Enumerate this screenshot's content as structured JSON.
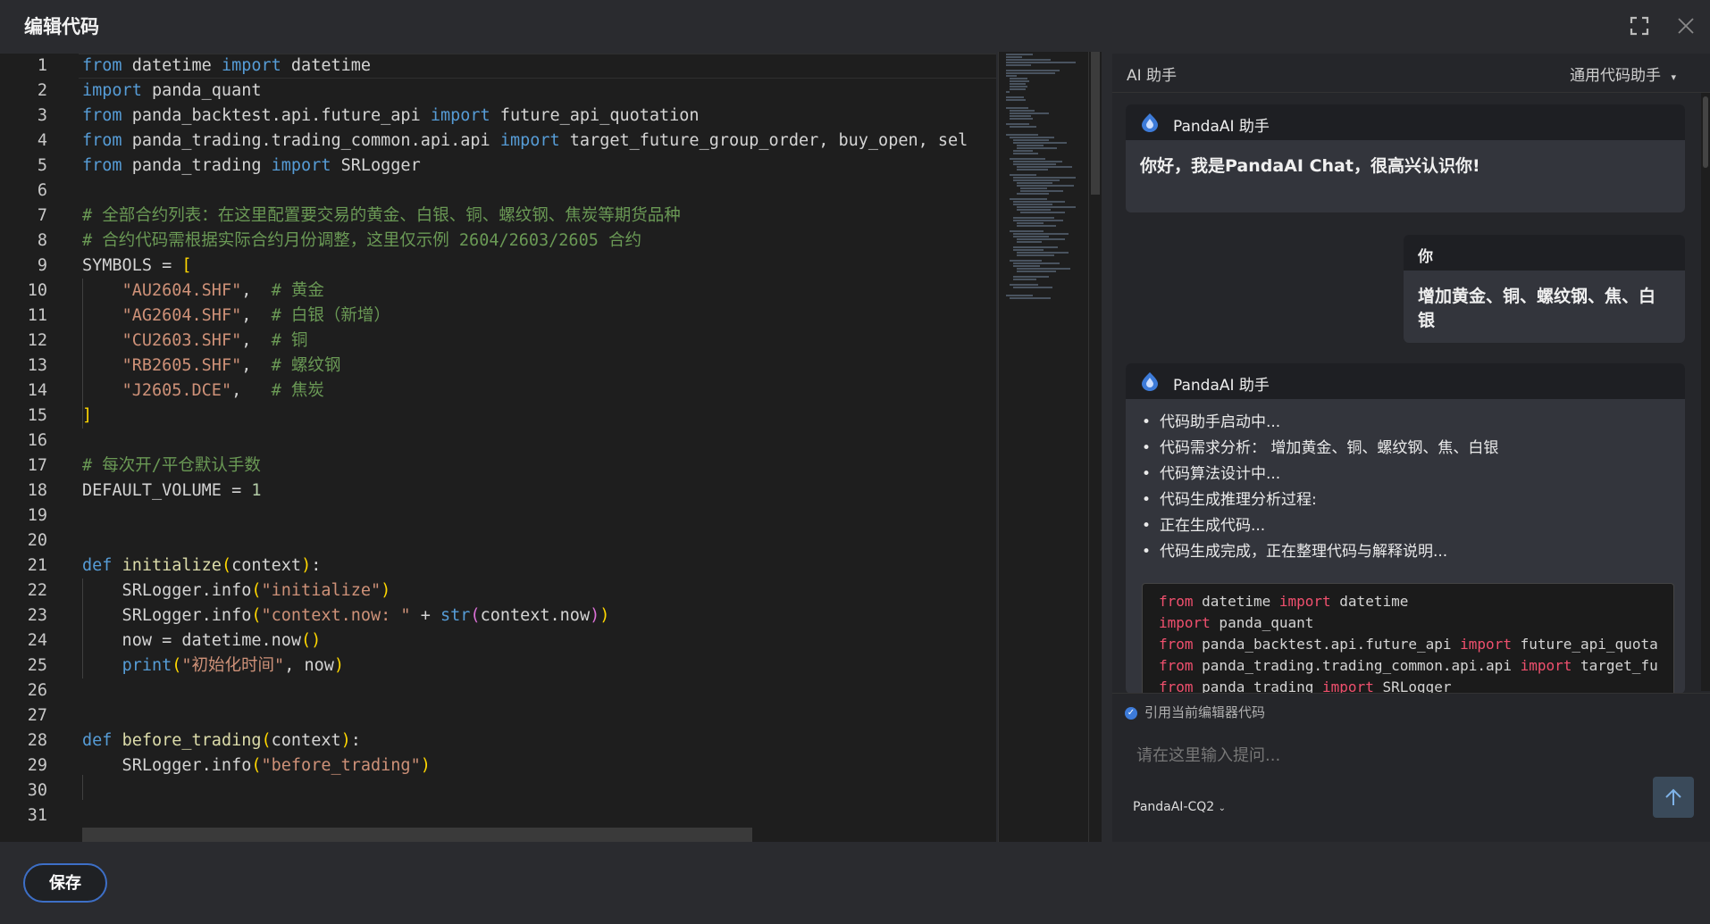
{
  "header": {
    "title": "编辑代码",
    "icons": [
      "fullscreen-icon",
      "close-icon"
    ]
  },
  "editor": {
    "line_numbers": [
      "1",
      "2",
      "3",
      "4",
      "5",
      "6",
      "7",
      "8",
      "9",
      "10",
      "11",
      "12",
      "13",
      "14",
      "15",
      "16",
      "17",
      "18",
      "19",
      "20",
      "21",
      "22",
      "23",
      "24",
      "25",
      "26",
      "27",
      "28",
      "29",
      "30",
      "31"
    ]
  },
  "ai_panel": {
    "title": "AI 助手",
    "mode": "通用代码助手",
    "assistant_name": "PandaAI 助手",
    "greeting": "你好，我是PandaAI Chat，很高兴认识你!",
    "user_name": "你",
    "user_message": "增加黄金、铜、螺纹钢、焦、白银",
    "steps": [
      "代码助手启动中...",
      "代码需求分析： 增加黄金、铜、螺纹钢、焦、白银",
      "代码算法设计中...",
      "代码生成推理分析过程:",
      "正在生成代码...",
      "代码生成完成，正在整理代码与解释说明..."
    ],
    "reference_label": "引用当前编辑器代码",
    "input_placeholder": "请在这里输入提问...",
    "model": "PandaAI-CQ2"
  },
  "footer": {
    "save_label": "保存"
  }
}
